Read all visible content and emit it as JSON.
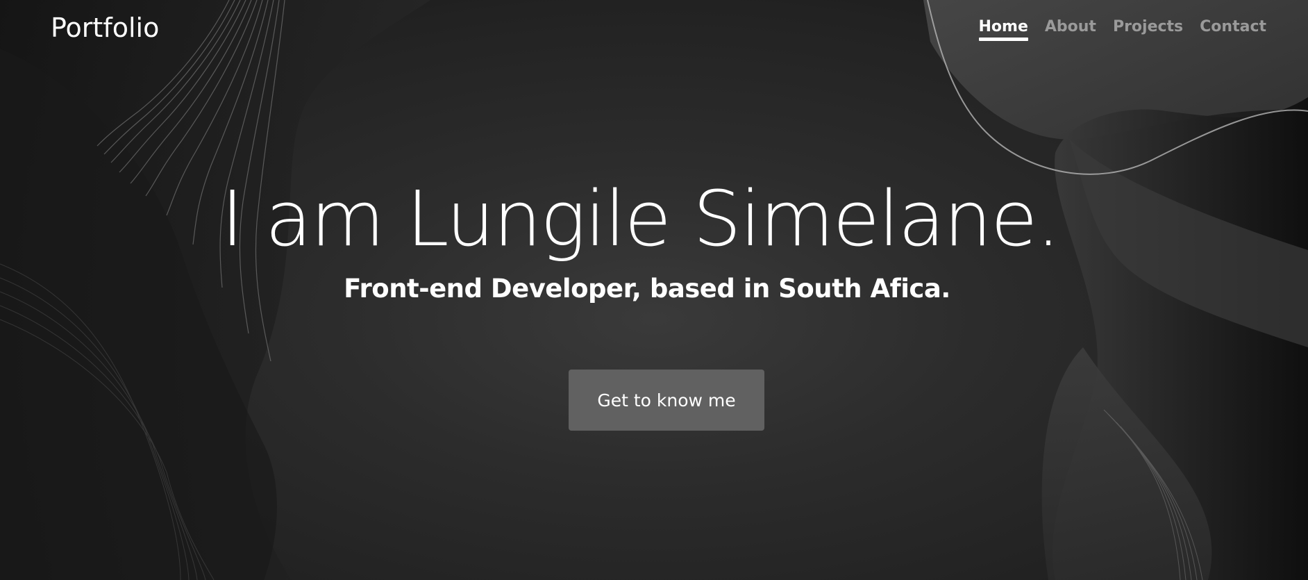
{
  "navbar": {
    "brand": "Portfolio",
    "links": [
      {
        "label": "Home"
      },
      {
        "label": "About"
      },
      {
        "label": "Projects"
      },
      {
        "label": "Contact"
      }
    ]
  },
  "hero": {
    "title": "I am Lungile Simelane.",
    "subtitle": "Front-end Developer, based in South Afica.",
    "cta_label": "Get to know me"
  },
  "colors": {
    "background": "#2c2c2c",
    "text": "#ffffff",
    "nav_inactive": "#9a9a9a",
    "button": "#616161"
  }
}
